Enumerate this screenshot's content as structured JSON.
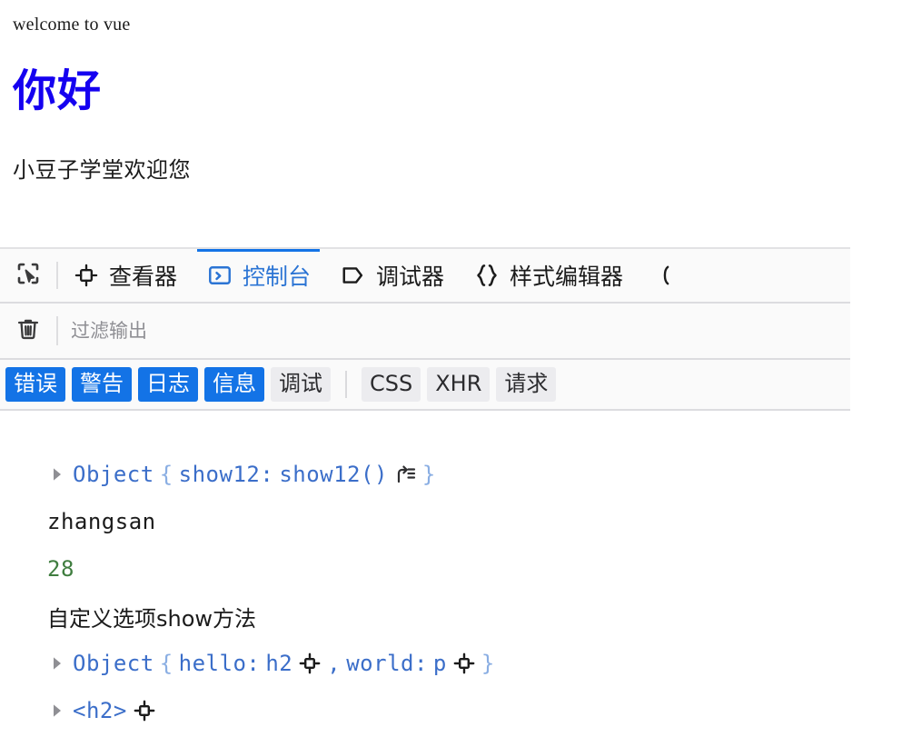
{
  "page": {
    "welcome_line": "welcome to vue",
    "hello_heading": "你好",
    "hello_color": "#1500f0",
    "sub_paragraph": "小豆子学堂欢迎您"
  },
  "devtools": {
    "toolbar": {
      "picker_icon": "element-picker-icon",
      "tabs": [
        {
          "label": "查看器",
          "icon": "inspector-icon",
          "active": false
        },
        {
          "label": "控制台",
          "icon": "console-icon",
          "active": true
        },
        {
          "label": "调试器",
          "icon": "debugger-icon",
          "active": false
        },
        {
          "label": "样式编辑器",
          "icon": "style-editor-icon",
          "active": false
        }
      ],
      "active_tab_color": "#1373e6"
    },
    "filter_bar": {
      "trash_icon": "trash-icon",
      "filter_placeholder": "过滤输出",
      "filter_value": ""
    },
    "filter_chips": [
      {
        "label": "错误",
        "state": "on"
      },
      {
        "label": "警告",
        "state": "on"
      },
      {
        "label": "日志",
        "state": "on"
      },
      {
        "label": "信息",
        "state": "on"
      },
      {
        "label": "调试",
        "state": "off"
      },
      {
        "label": "CSS",
        "state": "off"
      },
      {
        "label": "XHR",
        "state": "off"
      },
      {
        "label": "请求",
        "state": "off"
      }
    ],
    "chip_on_color": "#1373e6",
    "chip_off_color": "#ececef",
    "console_rows": [
      {
        "kind": "object",
        "expandable": true,
        "object_label": "Object",
        "open_brace": "{",
        "close_brace": "}",
        "prop_key": "show12:",
        "prop_value": "show12()",
        "trailing_icon": "jump-to-definition-icon"
      },
      {
        "kind": "text",
        "expandable": false,
        "text": "zhangsan"
      },
      {
        "kind": "number",
        "expandable": false,
        "text": "28",
        "color": "#3f7d3f"
      },
      {
        "kind": "text",
        "expandable": false,
        "text": "自定义选项show方法"
      },
      {
        "kind": "object-nodes",
        "expandable": true,
        "object_label": "Object",
        "open_brace": "{",
        "close_brace": "}",
        "prop1_key": "hello:",
        "prop1_value": "h2",
        "prop1_icon": "inspect-node-icon",
        "separator": ",",
        "prop2_key": "world:",
        "prop2_value": "p",
        "prop2_icon": "inspect-node-icon"
      },
      {
        "kind": "node",
        "expandable": true,
        "node_text": "<h2>",
        "node_icon": "inspect-node-icon"
      }
    ]
  }
}
